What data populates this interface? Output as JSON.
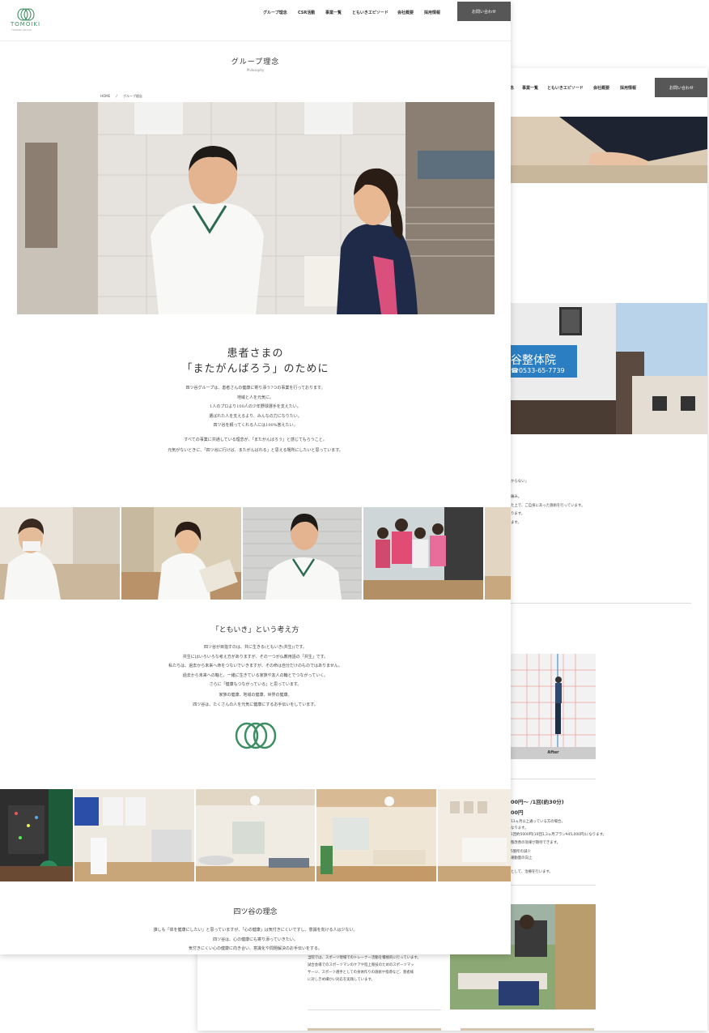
{
  "back_page": {
    "nav": [
      "事業一覧",
      "ともいきエピソード",
      "会社概要",
      "採用情報"
    ],
    "nav_partial": "念",
    "contact_label": "お問い合わせ",
    "sign_name": "谷整体院",
    "sign_phone": "☎0533-65-7739",
    "text_lines_1": [
      "からない」",
      "痛み。",
      "た上で、ご自身にあった施術を行っています。",
      "ります。",
      "ます。"
    ],
    "photo_caption_after": "After",
    "price_line_1": "00円〜 /1回(約30分)",
    "price_line_2": "00円",
    "text_lines_2": [
      "13ヵ月以上通っている方の場合。",
      "なります。",
      "1回約5000円(10回1,3ヵ月プラン¥45,000円)になります。",
      "態改善の効果が期待できます。",
      "5箇所の減少",
      "運動量の向上",
      "として、治療を行います。"
    ],
    "text_lines_3": [
      "当院では、スポーツ現場でのトレーナー活動を積極的に行っています。",
      "試合会場でのスポーツマンのケアや陸上競技のためのスポーツマッ",
      "サージ、スポーツ選手としての身体作りの施術や指導など、患者様",
      "に対しきめ細かい対応を実践しています。"
    ]
  },
  "header": {
    "logo": "TOMOIKI",
    "logo_sub": "TOMOIKI GROUP",
    "nav": [
      "グループ理念",
      "CSR活動",
      "事業一覧",
      "ともいきエピソード",
      "会社概要",
      "採用情報"
    ],
    "contact_label": "お問い合わせ"
  },
  "page_title": "グループ理念",
  "page_subtitle": "Philosophy",
  "breadcrumb": {
    "home": "HOME",
    "sep": "/",
    "current": "グループ理念"
  },
  "section1": {
    "heading_line1": "患者さまの",
    "heading_line2": "「またがんばろう」のために",
    "lines": [
      "四ツ谷グループは、患者さんの健康に寄り添う7つの事業を行っております。",
      "地域と人を元気に。",
      "1人のプロより100人の少年野球選手を支えたい。",
      "選ばれた人を支えるより、みんなの力になりたい。",
      "四ツ谷を頼ってくれる人には100%答えたい。",
      "すべての事業に共通している理念が、「またがんばろう」と感じてもらうこと。",
      "元気がないときに、「四ツ谷に行けば、またがんばれる」と思える場所にしたいと思っています。"
    ]
  },
  "section2": {
    "heading": "「ともいき」という考え方",
    "lines": [
      "四ツ谷が目指すのは、共に生きる(ともいき(共生))です。",
      "共生にはいろいろな考え方がありますが、その一つが仏教用語の「共生」です。",
      "私たちは、過去から未来へ命をつないでいきますが、その命は自分だけのものではありません。",
      "過去から未来への軸と、一緒に生きている家族や友人の輪とでつながっていく。",
      "さらに「健康もつながっている」と思っています。",
      "家族の健康、地域の健康、世界の健康。",
      "四ツ谷は、たくさんの人を元気に健康にするお手伝いをしています。"
    ]
  },
  "section3": {
    "heading": "四ツ谷の理念",
    "lines": [
      "誰しも「体を健康にしたい」と思っていますが、「心の健康」は気付きにくいですし、意識を向ける人は少ない。",
      "四ツ谷は、心の健康にも寄り添っていきたい。",
      "気付きにくい心の健康に向き合い、意識化や問題解決のお手伝いをする。"
    ]
  },
  "colors": {
    "accent": "#3e8e63",
    "button": "#575757"
  }
}
